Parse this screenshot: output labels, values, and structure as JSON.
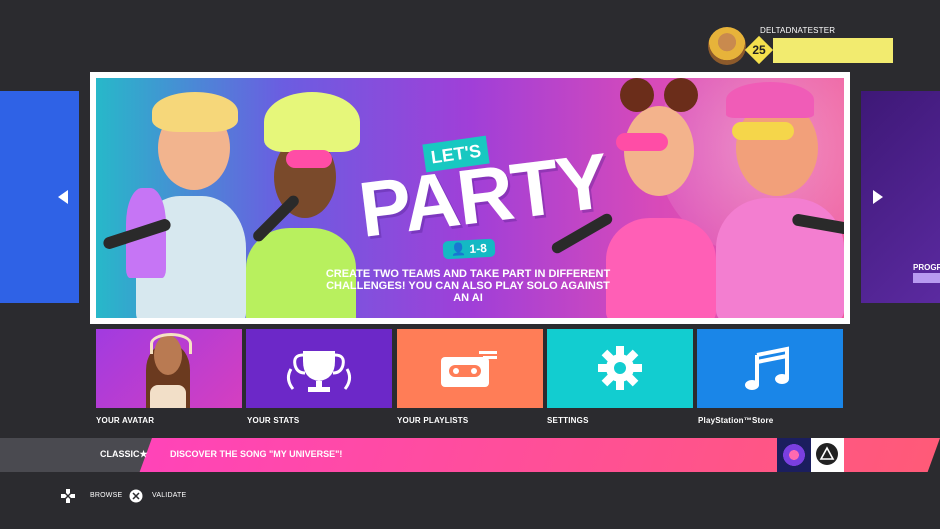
{
  "profile": {
    "username": "DELTADNATESTER",
    "level": "25",
    "colors": {
      "level_badge": "#f4e04d",
      "name_bar": "#f2eb6f"
    }
  },
  "carousel": {
    "banner": {
      "lets": "LET'S",
      "title": "PARTY",
      "players": "1-8",
      "description": "Create two teams and take part in different challenges! You can also play solo against an AI"
    },
    "next_label": "PROGR"
  },
  "tiles": [
    {
      "label": "YOUR AVATAR",
      "icon": "avatar-portrait",
      "color": "#b83ad6"
    },
    {
      "label": "YOUR STATS",
      "icon": "trophy-icon",
      "color": "#6c28c8"
    },
    {
      "label": "YOUR PLAYLISTS",
      "icon": "cassette-icon",
      "color": "#ff7d57"
    },
    {
      "label": "SETTINGS",
      "icon": "gear-icon",
      "color": "#12cdd0"
    },
    {
      "label": "PlayStation™Store",
      "icon": "music-note-icon",
      "color": "#1a86e8"
    }
  ],
  "ticker": {
    "mode": "CLASSIC★",
    "message": "DISCOVER THE SONG \"MY UNIVERSE\"!",
    "button_icon": "triangle-button-icon"
  },
  "footer": {
    "browse": "BROWSE",
    "validate": "VALIDATE",
    "browse_icon": "dpad-icon",
    "validate_icon": "cross-button-icon"
  }
}
